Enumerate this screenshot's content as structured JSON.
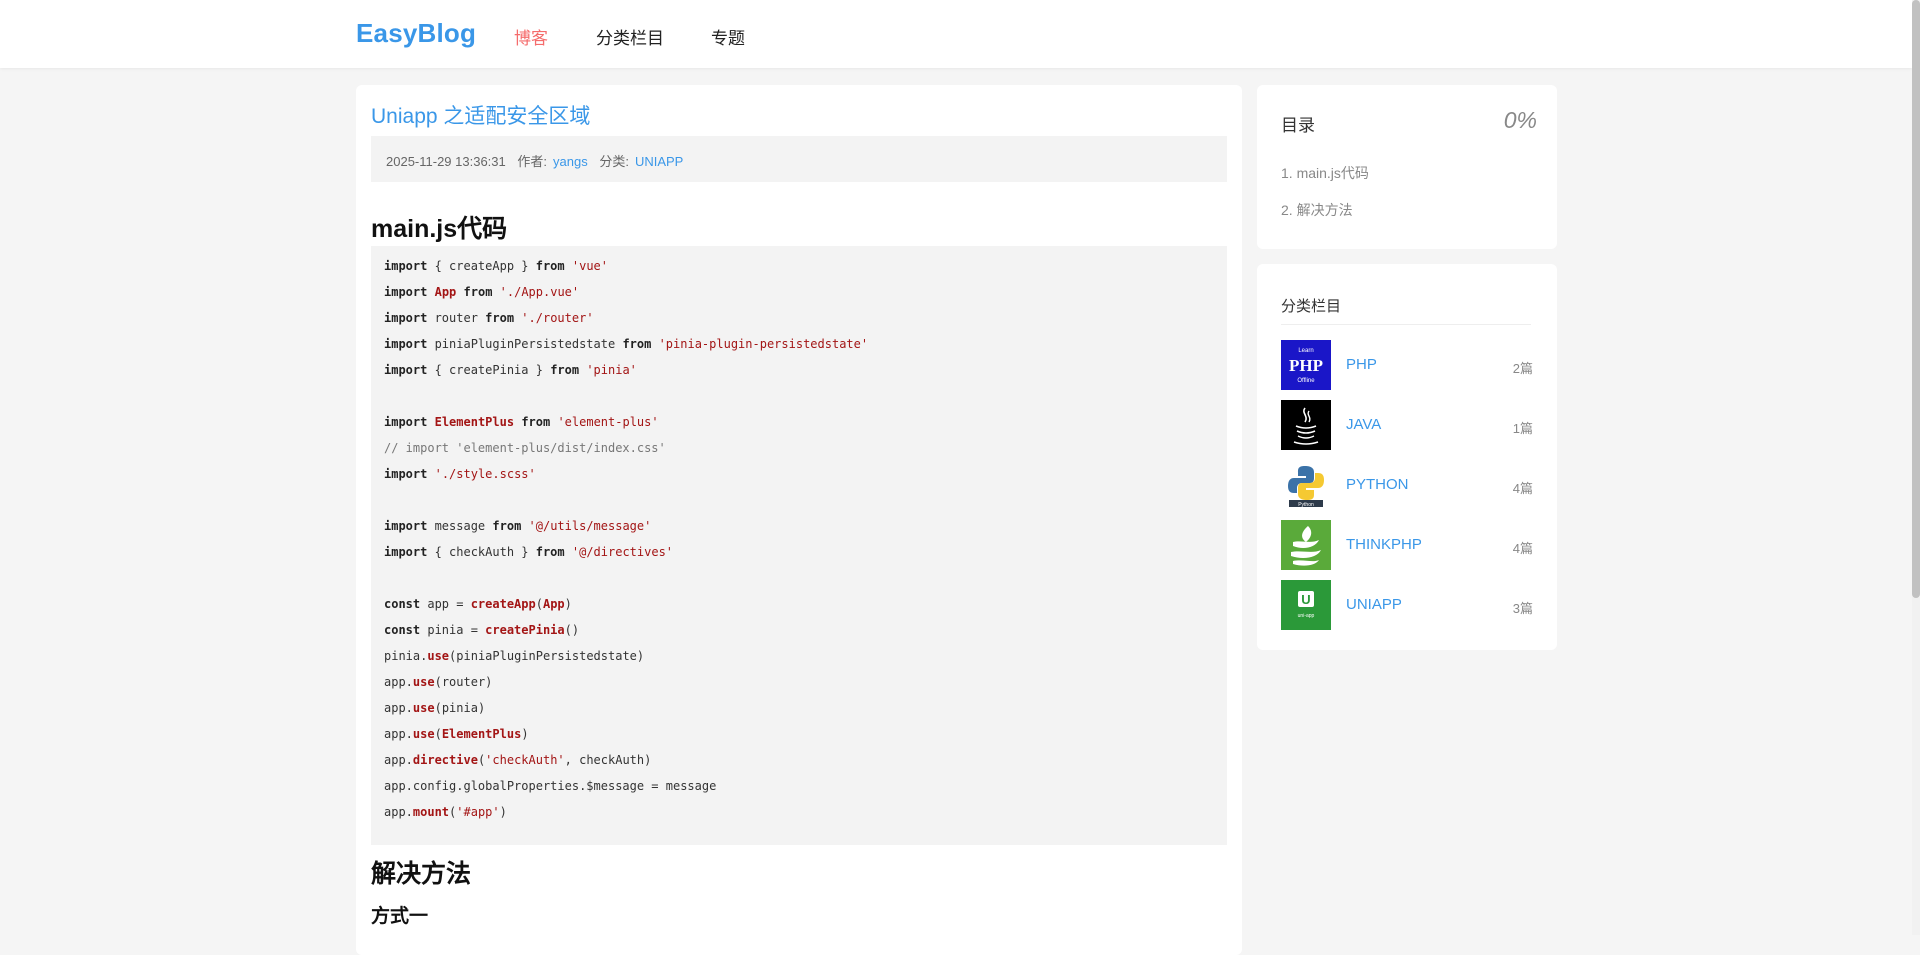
{
  "header": {
    "logo": "EasyBlog",
    "nav": [
      "博客",
      "分类栏目",
      "专题"
    ]
  },
  "article": {
    "title": "Uniapp 之适配安全区域",
    "date": "2025-11-29 13:36:31",
    "author_label": "作者:",
    "author": "yangs",
    "category_label": "分类:",
    "category": "UNIAPP",
    "section1": "main.js代码",
    "section2": "解决方法",
    "subsection": "方式一"
  },
  "toc": {
    "title": "目录",
    "percent": "0%",
    "items": [
      "1. main.js代码",
      "2. 解决方法"
    ]
  },
  "categories": {
    "title": "分类栏目",
    "items": [
      {
        "name": "PHP",
        "count": "2篇",
        "thumb_text": "PHP",
        "thumb_top": "Learn",
        "thumb_bottom": "Offline"
      },
      {
        "name": "JAVA",
        "count": "1篇"
      },
      {
        "name": "PYTHON",
        "count": "4篇",
        "thumb_text": "Python"
      },
      {
        "name": "THINKPHP",
        "count": "4篇"
      },
      {
        "name": "UNIAPP",
        "count": "3篇",
        "thumb_text": "U",
        "thumb_bottom": "uni-app"
      }
    ]
  },
  "colors": {
    "accent": "#3a97e8",
    "active_nav": "#f56c6c"
  }
}
